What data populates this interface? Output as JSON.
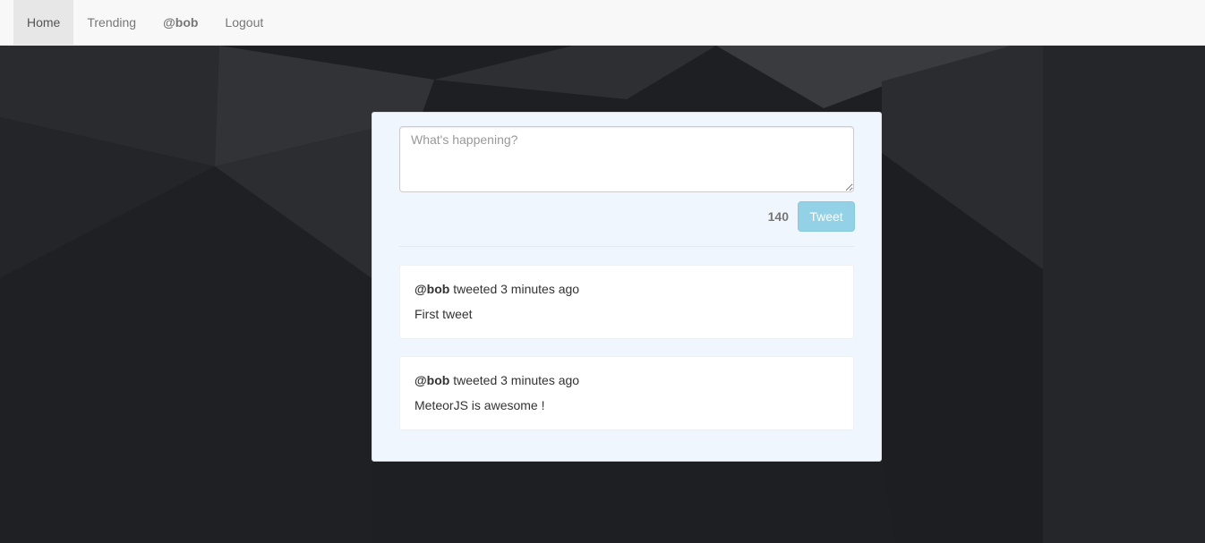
{
  "nav": {
    "items": [
      {
        "label": "Home",
        "active": true
      },
      {
        "label": "Trending",
        "active": false
      },
      {
        "label": "@bob",
        "active": false
      },
      {
        "label": "Logout",
        "active": false
      }
    ]
  },
  "composer": {
    "placeholder": "What's happening?",
    "value": "",
    "char_count": "140",
    "submit_label": "Tweet"
  },
  "tweets": [
    {
      "user": "@bob",
      "verb_time": "tweeted 3 minutes ago",
      "text": "First tweet"
    },
    {
      "user": "@bob",
      "verb_time": "tweeted 3 minutes ago",
      "text": "MeteorJS is awesome !"
    }
  ],
  "colors": {
    "background": "#1f2023",
    "navbar": "#f8f8f8",
    "card": "#f0f6fd",
    "tweet_button": "#92d1e6"
  }
}
